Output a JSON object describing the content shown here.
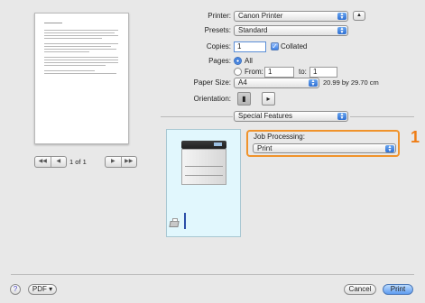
{
  "preview": {
    "page_indicator": "1 of 1"
  },
  "nav": {
    "first": "◀◀",
    "prev": "◀",
    "next": "▶",
    "last": "▶▶"
  },
  "form": {
    "printer_label": "Printer:",
    "printer_value": "Canon Printer",
    "expand_icon": "▲",
    "presets_label": "Presets:",
    "presets_value": "Standard",
    "copies_label": "Copies:",
    "copies_value": "1",
    "collated_label": "Collated",
    "pages_label": "Pages:",
    "pages_all_label": "All",
    "pages_from_label": "From:",
    "pages_from_value": "1",
    "pages_to_label": "to:",
    "pages_to_value": "1",
    "paper_size_label": "Paper Size:",
    "paper_size_value": "A4",
    "paper_size_dims": "20.99 by 29.70 cm",
    "orientation_label": "Orientation:",
    "section_value": "Special Features"
  },
  "job": {
    "label": "Job Processing:",
    "value": "Print",
    "callout": "1"
  },
  "footer": {
    "help": "?",
    "pdf": "PDF ▾",
    "cancel": "Cancel",
    "print": "Print"
  }
}
